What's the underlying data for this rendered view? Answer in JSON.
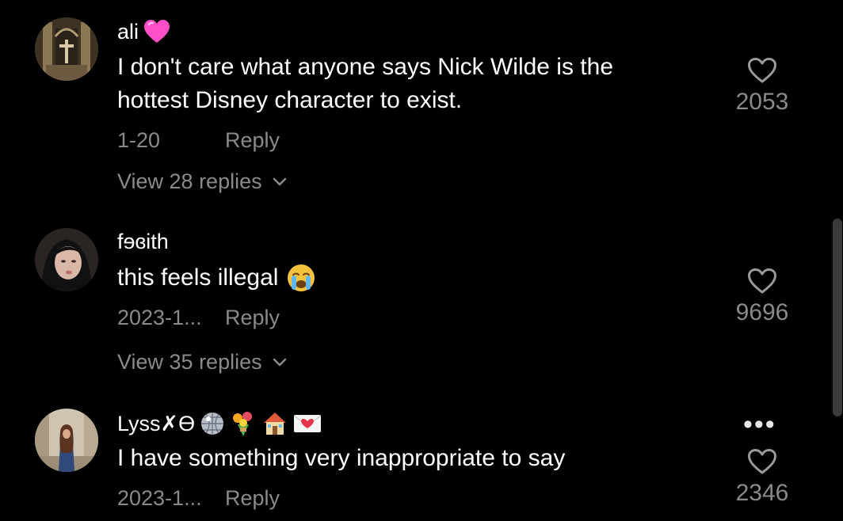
{
  "comments": [
    {
      "username": "ali",
      "username_emoji": "heart-icon",
      "text": "I don't care what anyone says Nick Wilde is the hottest Disney character to exist.",
      "date": "1-20",
      "reply_label": "Reply",
      "likes": "2053",
      "view_replies": "View 28 replies"
    },
    {
      "username": "fɘɞith",
      "text": "this feels illegal",
      "text_emoji": "crying-face-icon",
      "date": "2023-1...",
      "reply_label": "Reply",
      "likes": "9696",
      "view_replies": "View 35 replies"
    },
    {
      "username": "Lyss✗ϴ",
      "username_emojis": [
        "disco-ball-icon",
        "bouquet-icon",
        "house-icon",
        "love-letter-icon"
      ],
      "text": "I have something very inappropriate to say",
      "date": "2023-1...",
      "reply_label": "Reply",
      "likes": "2346",
      "more_label": "•••"
    }
  ],
  "colors": {
    "background": "#000000",
    "primary_text": "#ffffff",
    "secondary_text": "#8a8a8a",
    "heart_emoji": "#ff4fc8"
  }
}
